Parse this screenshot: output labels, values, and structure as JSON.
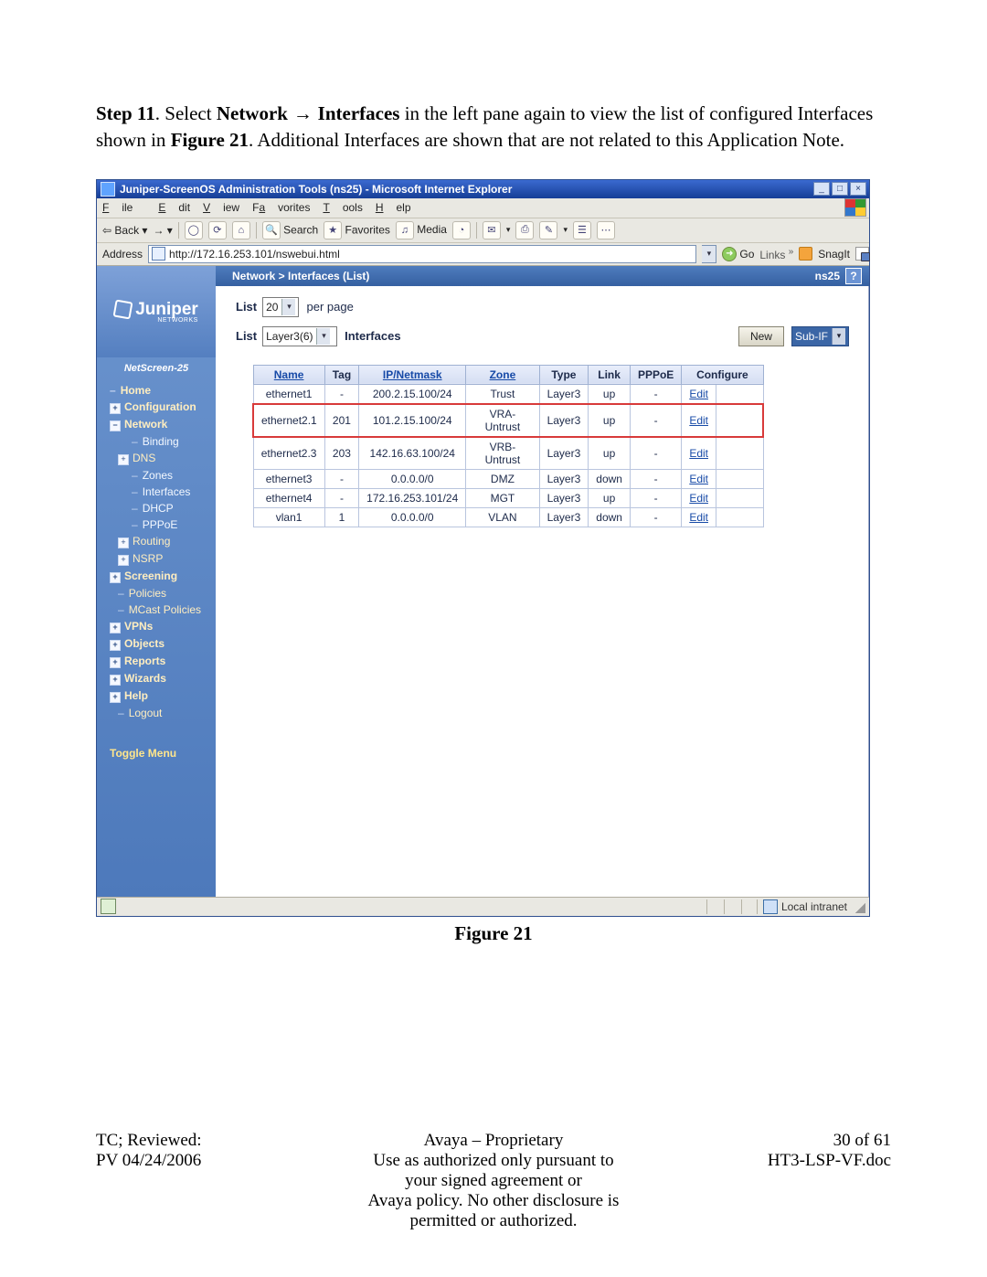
{
  "step": {
    "prefix": "Step 11",
    "text_before_nav": ". Select ",
    "nav_a": "Network",
    "arrow": " → ",
    "nav_b": "Interfaces",
    "text_after_nav": " in the left pane again to view the list of configured Interfaces shown in ",
    "figref": "Figure 21",
    "text_rest": ". Additional Interfaces are shown that are not related to this Application Note."
  },
  "browser": {
    "title": "Juniper-ScreenOS Administration Tools (ns25) - Microsoft Internet Explorer",
    "menus": {
      "file": "File",
      "edit": "Edit",
      "view": "View",
      "favorites": "Favorites",
      "tools": "Tools",
      "help": "Help"
    },
    "toolbar": {
      "back": "Back",
      "search": "Search",
      "favorites": "Favorites",
      "media": "Media"
    },
    "address_label": "Address",
    "url": "http://172.16.253.101/nswebui.html",
    "go": "Go",
    "links": "Links",
    "snagit": "SnagIt",
    "statusbar_zone": "Local intranet"
  },
  "app": {
    "brand": "Juniper",
    "brand_sub": "NETWORKS",
    "model": "NetScreen-25",
    "breadcrumb": "Network > Interfaces (List)",
    "hostname": "ns25",
    "help": "?",
    "sidebar": [
      {
        "label": "Home",
        "level": 0,
        "plus": false,
        "plain": true
      },
      {
        "label": "Configuration",
        "level": 0,
        "plus": true,
        "plain": false
      },
      {
        "label": "Network",
        "level": 0,
        "plus": true,
        "plain": false,
        "expanded": true
      },
      {
        "label": "Binding",
        "level": 2,
        "plus": false,
        "plain": true
      },
      {
        "label": "DNS",
        "level": 1,
        "plus": true,
        "plain": false
      },
      {
        "label": "Zones",
        "level": 2,
        "plus": false,
        "plain": true
      },
      {
        "label": "Interfaces",
        "level": 2,
        "plus": false,
        "plain": true
      },
      {
        "label": "DHCP",
        "level": 2,
        "plus": false,
        "plain": true
      },
      {
        "label": "PPPoE",
        "level": 2,
        "plus": false,
        "plain": true
      },
      {
        "label": "Routing",
        "level": 1,
        "plus": true,
        "plain": false
      },
      {
        "label": "NSRP",
        "level": 1,
        "plus": true,
        "plain": false
      },
      {
        "label": "Screening",
        "level": 0,
        "plus": true,
        "plain": false
      },
      {
        "label": "Policies",
        "level": 1,
        "plus": false,
        "plain": true
      },
      {
        "label": "MCast Policies",
        "level": 1,
        "plus": false,
        "plain": true
      },
      {
        "label": "VPNs",
        "level": 0,
        "plus": true,
        "plain": false
      },
      {
        "label": "Objects",
        "level": 0,
        "plus": true,
        "plain": false
      },
      {
        "label": "Reports",
        "level": 0,
        "plus": true,
        "plain": false
      },
      {
        "label": "Wizards",
        "level": 0,
        "plus": true,
        "plain": false
      },
      {
        "label": "Help",
        "level": 0,
        "plus": true,
        "plain": false
      },
      {
        "label": "Logout",
        "level": 1,
        "plus": false,
        "plain": true
      }
    ],
    "toggle_menu": "Toggle Menu",
    "controls": {
      "list_label": "List",
      "per_page_value": "20",
      "per_page_suffix": "per page",
      "filter_value": "Layer3(6)",
      "filter_suffix": "Interfaces",
      "new_button": "New",
      "new_type": "Sub-IF"
    },
    "table": {
      "headers": {
        "name": "Name",
        "tag": "Tag",
        "ip": "IP/Netmask",
        "zone": "Zone",
        "type": "Type",
        "link": "Link",
        "pppoe": "PPPoE",
        "configure": "Configure"
      },
      "edit": "Edit",
      "rows": [
        {
          "name": "ethernet1",
          "tag": "-",
          "ip": "200.2.15.100/24",
          "zone": "Trust",
          "type": "Layer3",
          "link": "up",
          "pppoe": "-",
          "hl": false
        },
        {
          "name": "ethernet2.1",
          "tag": "201",
          "ip": "101.2.15.100/24",
          "zone": "VRA-Untrust",
          "type": "Layer3",
          "link": "up",
          "pppoe": "-",
          "hl": true
        },
        {
          "name": "ethernet2.3",
          "tag": "203",
          "ip": "142.16.63.100/24",
          "zone": "VRB-Untrust",
          "type": "Layer3",
          "link": "up",
          "pppoe": "-",
          "hl": false
        },
        {
          "name": "ethernet3",
          "tag": "-",
          "ip": "0.0.0.0/0",
          "zone": "DMZ",
          "type": "Layer3",
          "link": "down",
          "pppoe": "-",
          "hl": false
        },
        {
          "name": "ethernet4",
          "tag": "-",
          "ip": "172.16.253.101/24",
          "zone": "MGT",
          "type": "Layer3",
          "link": "up",
          "pppoe": "-",
          "hl": false
        },
        {
          "name": "vlan1",
          "tag": "1",
          "ip": "0.0.0.0/0",
          "zone": "VLAN",
          "type": "Layer3",
          "link": "down",
          "pppoe": "-",
          "hl": false
        }
      ]
    }
  },
  "figure_caption": "Figure 21",
  "footer": {
    "left1": "TC; Reviewed:",
    "left2": "PV 04/24/2006",
    "center1": "Avaya – Proprietary",
    "center2": "Use as authorized only pursuant to your signed agreement or",
    "center3": "Avaya policy. No other disclosure is permitted or authorized.",
    "right1": "30 of 61",
    "right2": "HT3-LSP-VF.doc"
  }
}
